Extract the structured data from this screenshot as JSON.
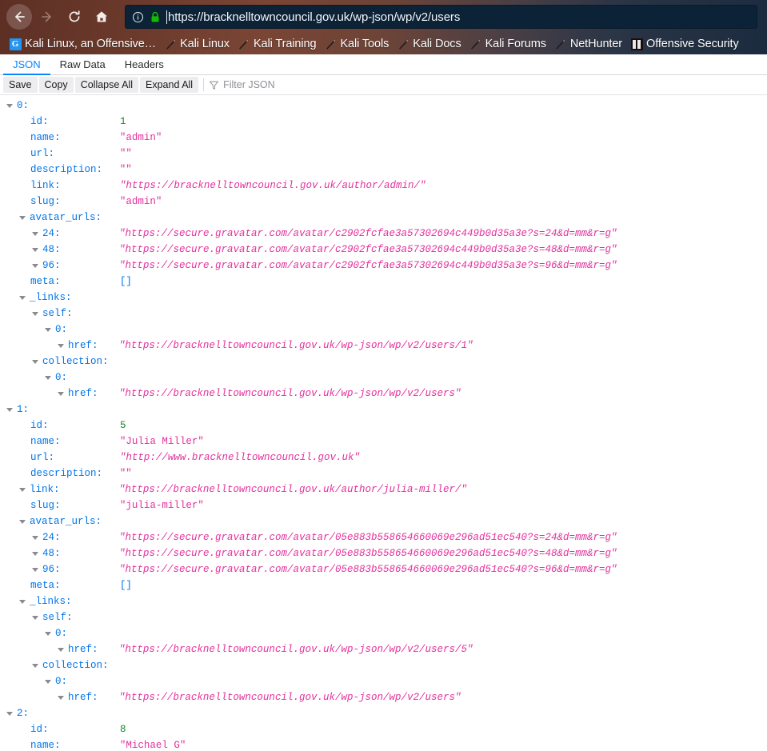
{
  "browser": {
    "nav": {
      "back_label": "Back",
      "forward_label": "Forward",
      "reload_label": "Reload",
      "home_label": "Home"
    },
    "urlbar": {
      "url": "https://bracknelltowncouncil.gov.uk/wp-json/wp/v2/users",
      "identity_icon": "info-circle-icon",
      "lock_icon": "padlock-secure-icon",
      "lock_color": "#12bc00"
    },
    "bookmarks": [
      {
        "label": "Kali Linux, an Offensive…",
        "icon": "google-g-favicon"
      },
      {
        "label": "Kali Linux",
        "icon": "kali-dragon-favicon"
      },
      {
        "label": "Kali Training",
        "icon": "kali-dragon-favicon"
      },
      {
        "label": "Kali Tools",
        "icon": "kali-dragon-favicon"
      },
      {
        "label": "Kali Docs",
        "icon": "kali-dragon-favicon"
      },
      {
        "label": "Kali Forums",
        "icon": "kali-dragon-favicon"
      },
      {
        "label": "NetHunter",
        "icon": "kali-dragon-favicon"
      },
      {
        "label": "Offensive Security",
        "icon": "offensive-security-favicon"
      }
    ]
  },
  "viewer": {
    "tabs": [
      {
        "label": "JSON",
        "active": true
      },
      {
        "label": "Raw Data",
        "active": false
      },
      {
        "label": "Headers",
        "active": false
      }
    ],
    "toolbar": {
      "save_label": "Save",
      "copy_label": "Copy",
      "collapse_all_label": "Collapse All",
      "expand_all_label": "Expand All",
      "filter_placeholder": "Filter JSON",
      "filter_value": "",
      "filter_icon": "funnel-filter-icon"
    },
    "accent_color": "#0a84ff",
    "key_color": "#0074e8",
    "string_color": "#e3309c",
    "number_color": "#0f8a28"
  },
  "json_rows": [
    {
      "indent": 0,
      "twisty": true,
      "key": "0:",
      "value": "",
      "type": "none"
    },
    {
      "indent": 1,
      "twisty": false,
      "key": "id:",
      "value": "1",
      "type": "num"
    },
    {
      "indent": 1,
      "twisty": false,
      "key": "name:",
      "value": "\"admin\"",
      "type": "str"
    },
    {
      "indent": 1,
      "twisty": false,
      "key": "url:",
      "value": "\"\"",
      "type": "str"
    },
    {
      "indent": 1,
      "twisty": false,
      "key": "description:",
      "value": "\"\"",
      "type": "str"
    },
    {
      "indent": 1,
      "twisty": false,
      "key": "link:",
      "value": "\"https://bracknelltowncouncil.gov.uk/author/admin/\"",
      "type": "url"
    },
    {
      "indent": 1,
      "twisty": false,
      "key": "slug:",
      "value": "\"admin\"",
      "type": "str"
    },
    {
      "indent": 1,
      "twisty": true,
      "key": "avatar_urls:",
      "value": "",
      "type": "none"
    },
    {
      "indent": 2,
      "twisty": true,
      "key": "24:",
      "value": "\"https://secure.gravatar.com/avatar/c2902fcfae3a57302694c449b0d35a3e?s=24&d=mm&r=g\"",
      "type": "url"
    },
    {
      "indent": 2,
      "twisty": true,
      "key": "48:",
      "value": "\"https://secure.gravatar.com/avatar/c2902fcfae3a57302694c449b0d35a3e?s=48&d=mm&r=g\"",
      "type": "url"
    },
    {
      "indent": 2,
      "twisty": true,
      "key": "96:",
      "value": "\"https://secure.gravatar.com/avatar/c2902fcfae3a57302694c449b0d35a3e?s=96&d=mm&r=g\"",
      "type": "url"
    },
    {
      "indent": 1,
      "twisty": false,
      "key": "meta:",
      "value": "[]",
      "type": "arr"
    },
    {
      "indent": 1,
      "twisty": true,
      "key": "_links:",
      "value": "",
      "type": "none"
    },
    {
      "indent": 2,
      "twisty": true,
      "key": "self:",
      "value": "",
      "type": "none"
    },
    {
      "indent": 3,
      "twisty": true,
      "key": "0:",
      "value": "",
      "type": "none"
    },
    {
      "indent": 4,
      "twisty": true,
      "key": "href:",
      "value": "\"https://bracknelltowncouncil.gov.uk/wp-json/wp/v2/users/1\"",
      "type": "url"
    },
    {
      "indent": 2,
      "twisty": true,
      "key": "collection:",
      "value": "",
      "type": "none"
    },
    {
      "indent": 3,
      "twisty": true,
      "key": "0:",
      "value": "",
      "type": "none"
    },
    {
      "indent": 4,
      "twisty": true,
      "key": "href:",
      "value": "\"https://bracknelltowncouncil.gov.uk/wp-json/wp/v2/users\"",
      "type": "url"
    },
    {
      "indent": 0,
      "twisty": true,
      "key": "1:",
      "value": "",
      "type": "none"
    },
    {
      "indent": 1,
      "twisty": false,
      "key": "id:",
      "value": "5",
      "type": "num"
    },
    {
      "indent": 1,
      "twisty": false,
      "key": "name:",
      "value": "\"Julia Miller\"",
      "type": "str"
    },
    {
      "indent": 1,
      "twisty": false,
      "key": "url:",
      "value": "\"http://www.bracknelltowncouncil.gov.uk\"",
      "type": "url"
    },
    {
      "indent": 1,
      "twisty": false,
      "key": "description:",
      "value": "\"\"",
      "type": "str"
    },
    {
      "indent": 1,
      "twisty": true,
      "key": "link:",
      "value": "\"https://bracknelltowncouncil.gov.uk/author/julia-miller/\"",
      "type": "url"
    },
    {
      "indent": 1,
      "twisty": false,
      "key": "slug:",
      "value": "\"julia-miller\"",
      "type": "str"
    },
    {
      "indent": 1,
      "twisty": true,
      "key": "avatar_urls:",
      "value": "",
      "type": "none"
    },
    {
      "indent": 2,
      "twisty": true,
      "key": "24:",
      "value": "\"https://secure.gravatar.com/avatar/05e883b558654660069e296ad51ec540?s=24&d=mm&r=g\"",
      "type": "url"
    },
    {
      "indent": 2,
      "twisty": true,
      "key": "48:",
      "value": "\"https://secure.gravatar.com/avatar/05e883b558654660069e296ad51ec540?s=48&d=mm&r=g\"",
      "type": "url"
    },
    {
      "indent": 2,
      "twisty": true,
      "key": "96:",
      "value": "\"https://secure.gravatar.com/avatar/05e883b558654660069e296ad51ec540?s=96&d=mm&r=g\"",
      "type": "url"
    },
    {
      "indent": 1,
      "twisty": false,
      "key": "meta:",
      "value": "[]",
      "type": "arr"
    },
    {
      "indent": 1,
      "twisty": true,
      "key": "_links:",
      "value": "",
      "type": "none"
    },
    {
      "indent": 2,
      "twisty": true,
      "key": "self:",
      "value": "",
      "type": "none"
    },
    {
      "indent": 3,
      "twisty": true,
      "key": "0:",
      "value": "",
      "type": "none"
    },
    {
      "indent": 4,
      "twisty": true,
      "key": "href:",
      "value": "\"https://bracknelltowncouncil.gov.uk/wp-json/wp/v2/users/5\"",
      "type": "url"
    },
    {
      "indent": 2,
      "twisty": true,
      "key": "collection:",
      "value": "",
      "type": "none"
    },
    {
      "indent": 3,
      "twisty": true,
      "key": "0:",
      "value": "",
      "type": "none"
    },
    {
      "indent": 4,
      "twisty": true,
      "key": "href:",
      "value": "\"https://bracknelltowncouncil.gov.uk/wp-json/wp/v2/users\"",
      "type": "url"
    },
    {
      "indent": 0,
      "twisty": true,
      "key": "2:",
      "value": "",
      "type": "none"
    },
    {
      "indent": 1,
      "twisty": false,
      "key": "id:",
      "value": "8",
      "type": "num"
    },
    {
      "indent": 1,
      "twisty": false,
      "key": "name:",
      "value": "\"Michael G\"",
      "type": "str"
    }
  ]
}
